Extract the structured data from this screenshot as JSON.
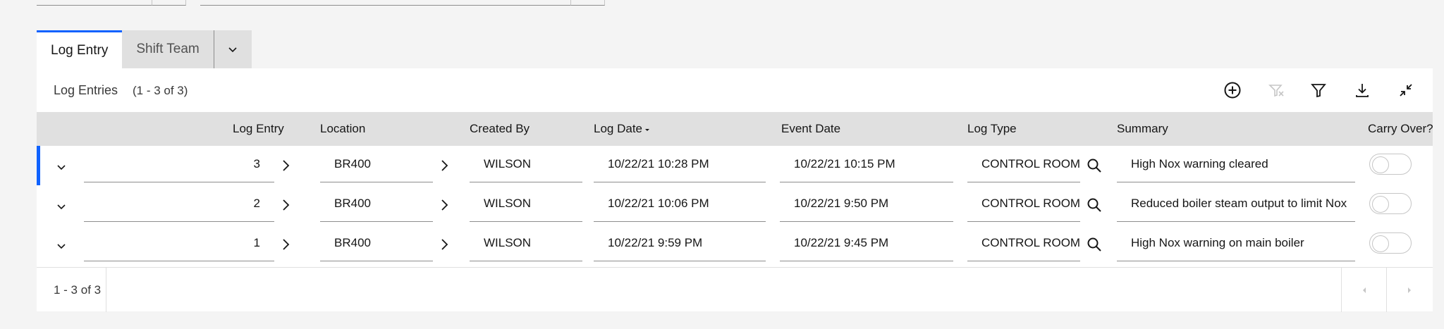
{
  "tabs": [
    {
      "label": "Log Entry",
      "active": true
    },
    {
      "label": "Shift Team",
      "active": false
    }
  ],
  "toolbar": {
    "title": "Log Entries",
    "count": "(1 - 3 of 3)",
    "icons": [
      "add-icon",
      "clear-filter-icon",
      "filter-icon",
      "download-icon",
      "collapse-icon"
    ]
  },
  "columns": [
    "Log Entry",
    "Location",
    "Created By",
    "Log Date",
    "Event Date",
    "Log Type",
    "Summary",
    "Carry Over?"
  ],
  "rows": [
    {
      "log_entry": "3",
      "location": "BR400",
      "created_by": "WILSON",
      "log_date": "10/22/21 10:28 PM",
      "event_date": "10/22/21 10:15 PM",
      "log_type": "CONTROL ROOM",
      "summary": "High Nox warning cleared",
      "carry_over": false
    },
    {
      "log_entry": "2",
      "location": "BR400",
      "created_by": "WILSON",
      "log_date": "10/22/21 10:06 PM",
      "event_date": "10/22/21 9:50 PM",
      "log_type": "CONTROL ROOM",
      "summary": "Reduced boiler steam output to limit Nox",
      "carry_over": false
    },
    {
      "log_entry": "1",
      "location": "BR400",
      "created_by": "WILSON",
      "log_date": "10/22/21 9:59 PM",
      "event_date": "10/22/21 9:45 PM",
      "log_type": "CONTROL ROOM",
      "summary": "High Nox warning on main boiler",
      "carry_over": false
    }
  ],
  "footer": {
    "count": "1 - 3 of 3"
  },
  "colors": {
    "accent": "#0f62fe",
    "header_bg": "#e0e0e0",
    "page_bg": "#f4f4f4"
  }
}
